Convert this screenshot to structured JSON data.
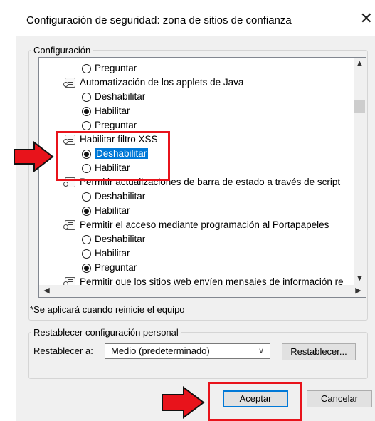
{
  "dialog": {
    "title": "Configuración de seguridad: zona de sitios de confianza",
    "close_symbol": "✕"
  },
  "settings_group": {
    "label": "Configuración"
  },
  "tree": {
    "rows": [
      {
        "kind": "radio",
        "label": "Preguntar",
        "checked": false
      },
      {
        "kind": "category",
        "label": "Automatización de los applets de Java"
      },
      {
        "kind": "radio",
        "label": "Deshabilitar",
        "checked": false
      },
      {
        "kind": "radio",
        "label": "Habilitar",
        "checked": true
      },
      {
        "kind": "radio",
        "label": "Preguntar",
        "checked": false
      },
      {
        "kind": "category",
        "label": "Habilitar filtro XSS"
      },
      {
        "kind": "radio",
        "label": "Deshabilitar",
        "checked": true,
        "selected": true
      },
      {
        "kind": "radio",
        "label": "Habilitar",
        "checked": false
      },
      {
        "kind": "category",
        "label": "Permitir actualizaciones de barra de estado a través de script"
      },
      {
        "kind": "radio",
        "label": "Deshabilitar",
        "checked": false
      },
      {
        "kind": "radio",
        "label": "Habilitar",
        "checked": true
      },
      {
        "kind": "category",
        "label": "Permitir el acceso mediante programación al Portapapeles"
      },
      {
        "kind": "radio",
        "label": "Deshabilitar",
        "checked": false
      },
      {
        "kind": "radio",
        "label": "Habilitar",
        "checked": false
      },
      {
        "kind": "radio",
        "label": "Preguntar",
        "checked": true
      },
      {
        "kind": "category",
        "label": "Permitir que los sitios web envíen mensajes de información re"
      }
    ],
    "scroll_up": "▲",
    "scroll_down": "▼",
    "scroll_left": "◀",
    "scroll_right": "▶"
  },
  "note": "*Se aplicará cuando reinicie el equipo",
  "reset_group": {
    "label": "Restablecer configuración personal",
    "reset_to_label": "Restablecer a:",
    "selected_level": "Medio (predeterminado)",
    "reset_button": "Restablecer..."
  },
  "footer": {
    "ok_button": "Aceptar",
    "cancel_button": "Cancelar"
  },
  "colors": {
    "highlight": "#e8131b",
    "selection": "#0078d7"
  }
}
